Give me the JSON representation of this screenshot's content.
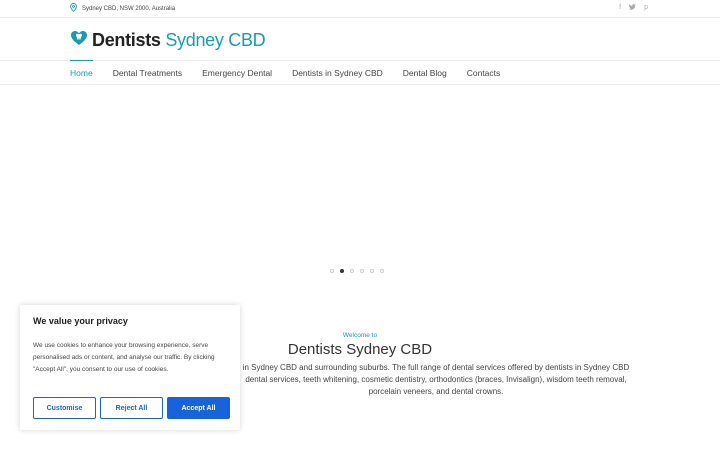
{
  "topbar": {
    "location": "Sydney CBD, NSW 2000, Australia",
    "social": [
      {
        "name": "facebook-icon",
        "glyph": "f"
      },
      {
        "name": "twitter-icon",
        "glyph": "t"
      },
      {
        "name": "pinterest-icon",
        "glyph": "p"
      }
    ]
  },
  "brand": {
    "bold": "Dentists",
    "light": "Sydney CBD",
    "accent": "#1a9cb0"
  },
  "nav": {
    "items": [
      {
        "label": "Home"
      },
      {
        "label": "Dental Treatments"
      },
      {
        "label": "Emergency Dental"
      },
      {
        "label": "Dentists in Sydney CBD"
      },
      {
        "label": "Dental Blog"
      },
      {
        "label": "Contacts"
      }
    ]
  },
  "slider": {
    "slides": 6,
    "active_index": 1
  },
  "hero": {
    "kicker": "Welcome to",
    "title": "Dentists Sydney CBD",
    "paragraph_lines": [
      "in Sydney CBD and surrounding suburbs. The full range of dental services offered by dentists in Sydney CBD",
      "dental services, teeth whitening, cosmetic dentistry, orthodontics (braces, Invisalign), wisdom teeth removal,",
      "porcelain veneers, and dental crowns."
    ]
  },
  "cookie": {
    "title": "We value your privacy",
    "text": "We use cookies to enhance your browsing experience, serve personalised ads or content, and analyse our traffic. By clicking \"Accept All\", you consent to our use of cookies.",
    "customise_label": "Customise",
    "reject_label": "Reject All",
    "accept_label": "Accept All",
    "button_color": "#1863dc"
  }
}
